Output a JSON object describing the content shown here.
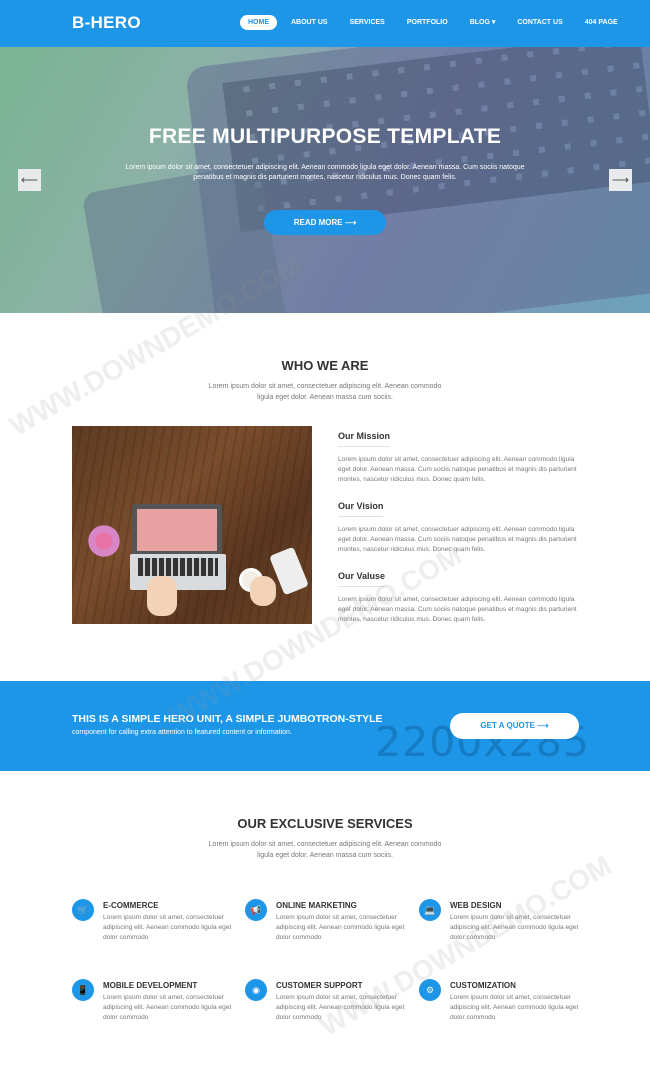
{
  "nav": {
    "brand": "B-HERO",
    "items": [
      "HOME",
      "ABOUT US",
      "SERVICES",
      "PORTFOLIO",
      "BLOG ▾",
      "CONTACT US",
      "404 PAGE"
    ]
  },
  "hero": {
    "title": "FREE MULTIPURPOSE TEMPLATE",
    "text": "Lorem ipsum dolor sit amet, consectetuer adipiscing elit. Aenean commodo ligula eget dolor. Aenean massa. Cum sociis natoque penatibus et magnis dis parturient montes, nascetur ridiculus mus. Donec quam felis.",
    "button": "READ MORE ⟶",
    "prev": "⟵",
    "next": "⟶"
  },
  "about": {
    "title": "WHO WE ARE",
    "subtitle": "Lorem ipsum dolor sit amet, consectetuer adipiscing elit. Aenean commodo ligula eget dolor. Aenean massa cum sociis.",
    "blocks": [
      {
        "title": "Our Mission",
        "text": "Lorem ipsum dolor sit amet, consectetuer adipiscing elit. Aenean commodo ligula eget dolor. Aenean massa. Cum sociis natoque penatibus et magnis dis parturient montes, nascetur ridiculus mus. Donec quam felis."
      },
      {
        "title": "Our Vision",
        "text": "Lorem ipsum dolor sit amet, consectetuer adipiscing elit. Aenean commodo ligula eget dolor. Aenean massa. Cum sociis natoque penatibus et magnis dis parturient montes, nascetur ridiculus mus. Donec quam felis."
      },
      {
        "title": "Our Valuse",
        "text": "Lorem ipsum dolor sit amet, consectetuer adipiscing elit. Aenean commodo ligula eget dolor. Aenean massa. Cum sociis natoque penatibus et magnis dis parturient montes, nascetur ridiculus mus. Donec quam felis."
      }
    ]
  },
  "cta": {
    "title": "THIS IS A SIMPLE HERO UNIT, A SIMPLE JUMBOTRON-STYLE",
    "text": "component for calling extra attention to featured content or information.",
    "button": "GET A QUOTE ⟶",
    "dimension": "2200x285"
  },
  "services": {
    "title": "OUR EXCLUSIVE SERVICES",
    "subtitle": "Lorem ipsum dolor sit amet, consectetuer adipiscing elit. Aenean commodo ligula eget dolor. Aenean massa cum sociis.",
    "items": [
      {
        "title": "E-COMMERCE",
        "icon": "cart-icon",
        "glyph": "🛒",
        "text": "Lorem ipsum dolor sit amet, consectetuer adipiscing elit. Aenean commodo ligula eget dolor commodo"
      },
      {
        "title": "ONLINE MARKETING",
        "icon": "megaphone-icon",
        "glyph": "📢",
        "text": "Lorem ipsum dolor sit amet, consectetuer adipiscing elit. Aenean commodo ligula eget dolor commodo"
      },
      {
        "title": "WEB DESIGN",
        "icon": "laptop-icon",
        "glyph": "💻",
        "text": "Lorem ipsum dolor sit amet, consectetuer adipiscing elit. Aenean commodo ligula eget dolor commodo"
      },
      {
        "title": "MOBILE DEVELOPMENT",
        "icon": "mobile-icon",
        "glyph": "📱",
        "text": "Lorem ipsum dolor sit amet, consectetuer adipiscing elit. Aenean commodo ligula eget dolor commodo"
      },
      {
        "title": "CUSTOMER SUPPORT",
        "icon": "support-icon",
        "glyph": "◉",
        "text": "Lorem ipsum dolor sit amet, consectetuer adipiscing elit. Aenean commodo ligula eget dolor commodo"
      },
      {
        "title": "CUSTOMIZATION",
        "icon": "gear-icon",
        "glyph": "⚙",
        "text": "Lorem ipsum dolor sit amet, consectetuer adipiscing elit. Aenean commodo ligula eget dolor commodo"
      }
    ]
  },
  "watermark": "WWW.DOWNDEMO.COM",
  "colors": {
    "accent": "#1e96e8",
    "text": "#333333",
    "muted": "#777777"
  }
}
